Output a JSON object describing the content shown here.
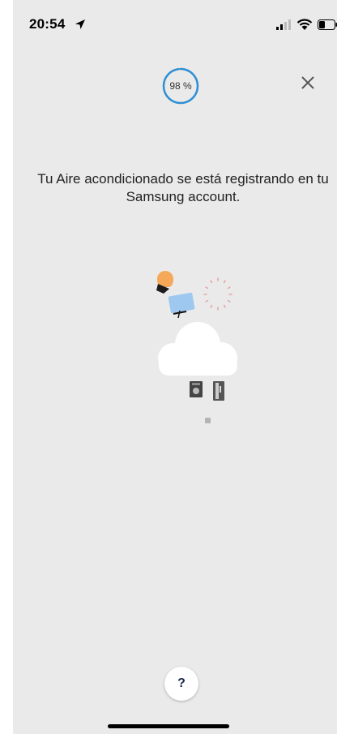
{
  "status_bar": {
    "time": "20:54",
    "icons": [
      "location-arrow-icon",
      "signal-icon",
      "wifi-icon",
      "battery-icon"
    ]
  },
  "progress": {
    "label": "98 %",
    "value": 98,
    "color": "#2d8fd5"
  },
  "close": {
    "icon": "close-icon"
  },
  "message": {
    "text": "Tu Aire acondicionado se está registrando en tu Samsung account."
  },
  "illustration": {
    "icons": [
      "lightbulb-icon",
      "tv-icon",
      "loading-dots-icon",
      "cloud-icon",
      "washer-icon",
      "fridge-icon",
      "sensor-icon"
    ]
  },
  "help": {
    "label": "?"
  }
}
